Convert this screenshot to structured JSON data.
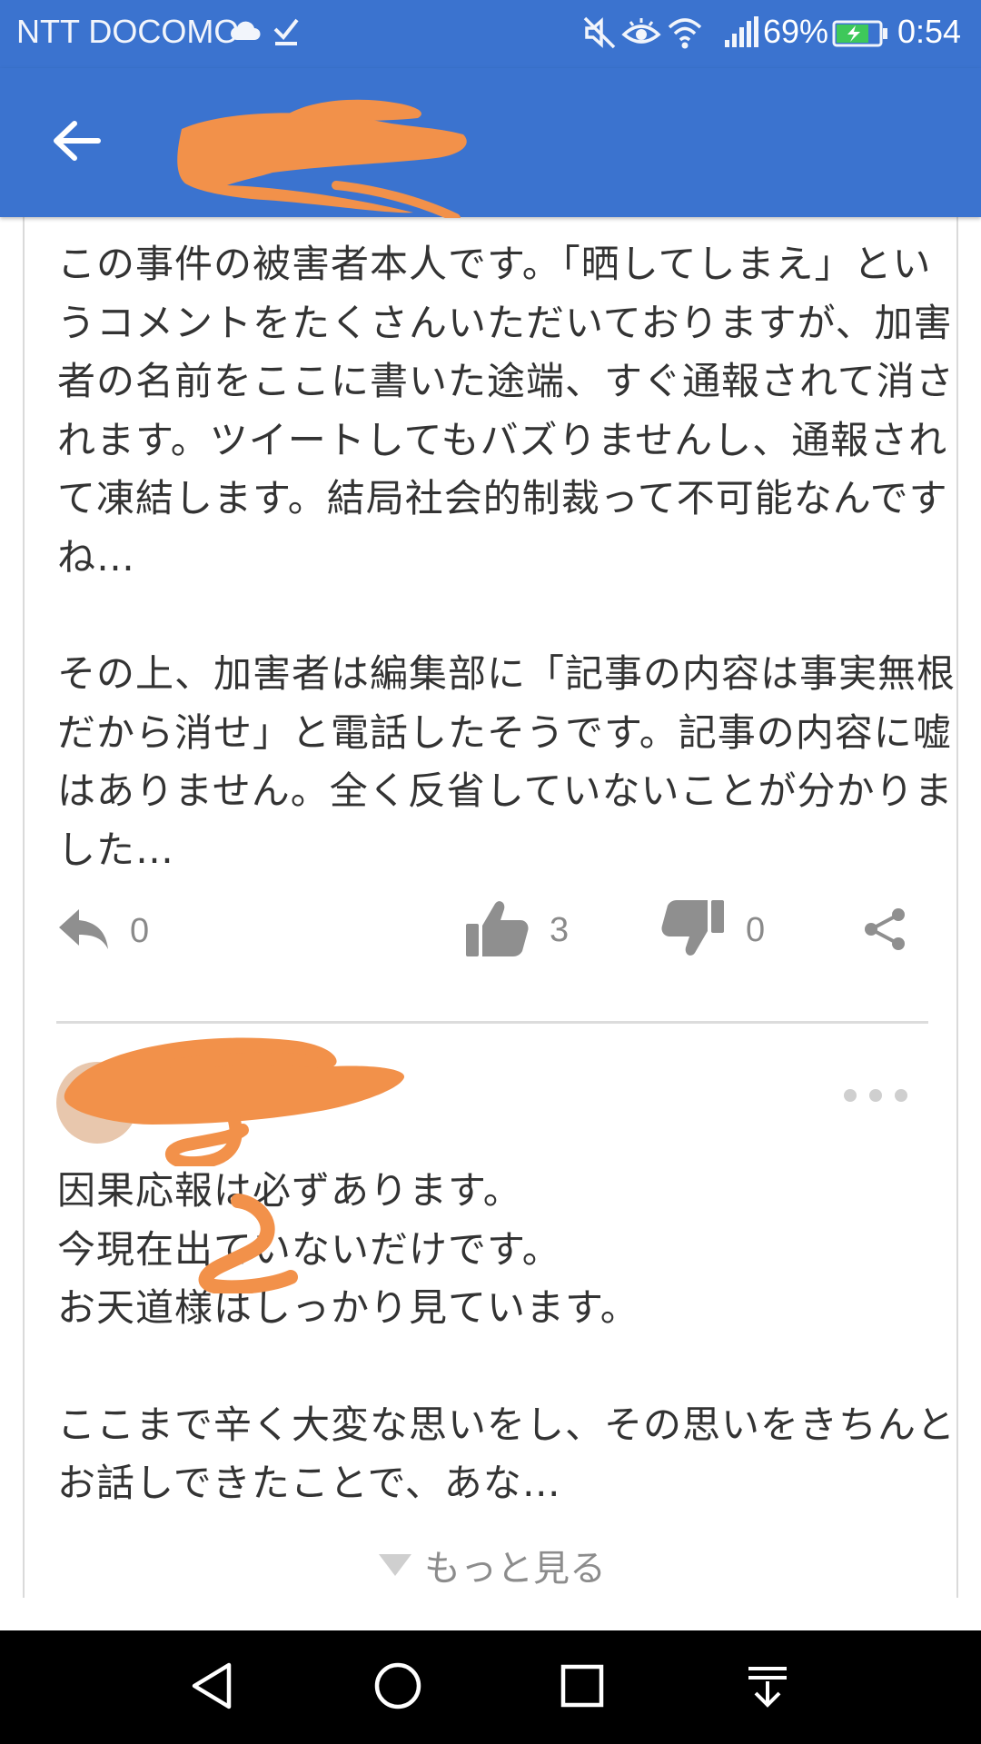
{
  "status_bar": {
    "carrier": "NTT DOCOMO",
    "battery_percent": "69%",
    "time": "0:54",
    "icons": [
      "cloud-icon",
      "download-done-icon",
      "mute-icon",
      "eye-icon",
      "wifi-icon",
      "signal-icon",
      "battery-charging-icon"
    ]
  },
  "app_bar": {
    "back_icon": "arrow-left-icon"
  },
  "comments": [
    {
      "paragraphs": [
        "この事件の被害者本人です。「晒してしまえ」というコメントをたくさんいただいておりますが、加害者の名前をここに書いた途端、すぐ通報されて消されます。ツイートしてもバズりませんし、通報されて凍結します。結局社会的制裁って不可能なんですね…",
        "その上、加害者は編集部に「記事の内容は事実無根だから消せ」と電話したそうです。記事の内容に嘘はありません。全く反省していないことが分かりました…"
      ],
      "actions": {
        "reply_count": "0",
        "like_count": "3",
        "dislike_count": "0"
      }
    },
    {
      "paragraphs": [
        "因果応報は必ずあります。\n今現在出ていないだけです。\nお天道様はしっかり見ています。",
        "ここまで辛く大変な思いをし、その思いをきちんとお話しできたことで、あな…"
      ]
    }
  ],
  "see_more_label": "もっと見る",
  "colors": {
    "header_blue": "#3b73cf",
    "redaction_orange": "#f2914a",
    "text": "#333333",
    "muted": "#8a8a8a",
    "icon_gray": "#8f8f8f"
  }
}
